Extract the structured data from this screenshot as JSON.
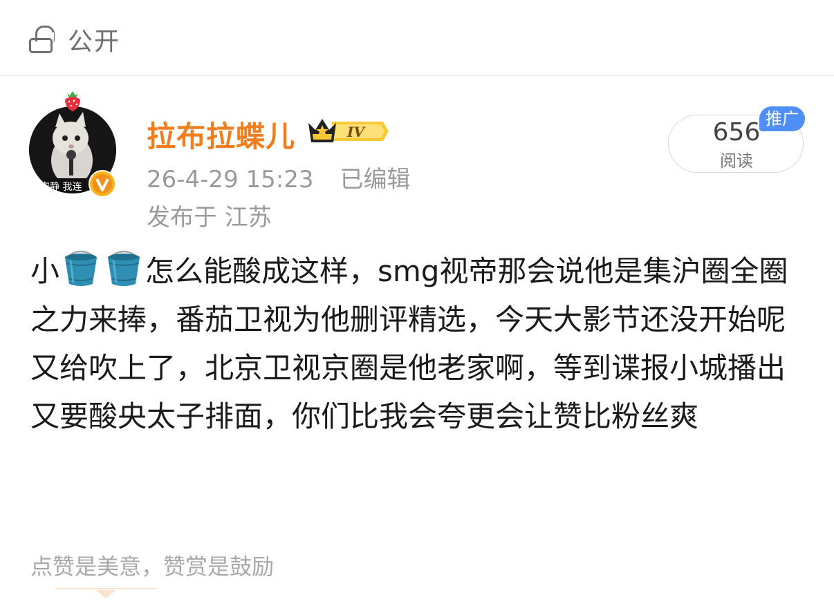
{
  "header": {
    "visibility_label": "公开"
  },
  "author": {
    "name": "拉布拉蝶儿",
    "level_badge": "IV",
    "avatar_caption": "安静 我连"
  },
  "post_meta": {
    "timestamp": "26-4-29 15:23",
    "edited_label": "已编辑",
    "location": "发布于 江苏"
  },
  "views": {
    "count": "656",
    "label": "阅读",
    "promo_tag": "推广"
  },
  "content": {
    "segments": [
      "小",
      "怎么能酸成这样，smg视帝那会说他是集沪圈全圈之力来捧，番茄卫视为他删评精选，今天大影节还没开始呢又给吹上了，北京卫视京圈是他老家啊，等到谍报小城播出又要酸央太子排面，你们比我会夸更会让赞比粉丝爽"
    ]
  },
  "footer": {
    "reward_hint": "点赞是美意，赞赏是鼓励"
  },
  "colors": {
    "username": "#f07d1e",
    "muted": "#9a9a9a",
    "promo": "#4f8ef5",
    "bucket": "#2e8fb3"
  }
}
